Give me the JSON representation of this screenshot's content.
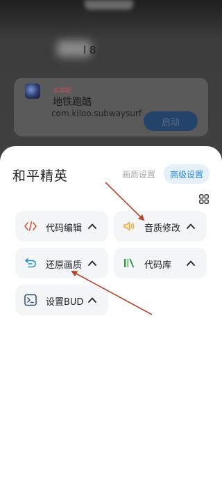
{
  "background_app": {
    "title_suffix": "l 8",
    "card": {
      "tag": "未适配",
      "app_name": "地铁跑酷",
      "package": "com.kiloo.subwaysurf",
      "launch_label": "启动"
    }
  },
  "sheet": {
    "title": "和平精英",
    "tabs": {
      "quality": "画质设置",
      "advanced": "高级设置"
    },
    "tools": [
      {
        "label": "代码编辑",
        "icon": "code-icon"
      },
      {
        "label": "音质修改",
        "icon": "speaker-icon"
      },
      {
        "label": "还原画质",
        "icon": "restore-icon"
      },
      {
        "label": "代码库",
        "icon": "library-icon"
      },
      {
        "label": "设置BUD",
        "icon": "terminal-icon"
      }
    ]
  },
  "colors": {
    "accent": "#2f89d6",
    "annotation_arrow": "#b5472c",
    "code_icon": "#d2553a",
    "speaker_icon": "#e8a83a",
    "restore_icon": "#1f8fb8",
    "library_icon": "#3a9a4a",
    "terminal_icon": "#2a4e6e"
  }
}
